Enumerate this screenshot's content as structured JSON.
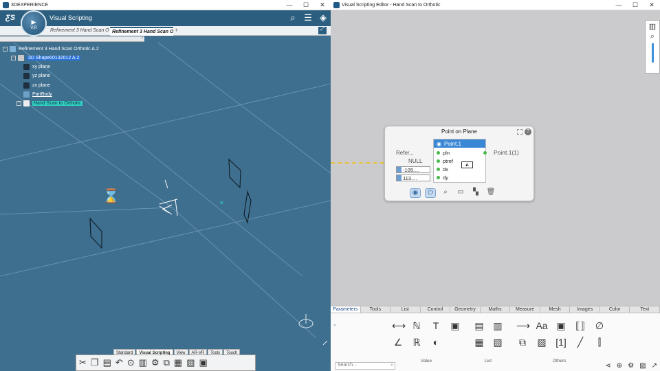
{
  "left_window": {
    "title": "3DEXPERIENCE",
    "app_title": "Visual Scripting",
    "compass_label": "V.R",
    "tabs": [
      "Refinement 3 Hand Scan O",
      "Refinement 3 Hand Scan O"
    ],
    "tree": {
      "root": "Refinement 3 Hand Scan Orthotic A.2",
      "shape": "3D Shape00132012 A.2",
      "xy": "xy plane",
      "yz": "yz plane",
      "zx": "zx plane",
      "partbody": "PartBody",
      "handscan": "Hand Scan to Orthotic"
    },
    "toolbar_tabs": [
      "Standard",
      "Visual Scripting",
      "View",
      "AR-VR",
      "Tools",
      "Touch"
    ]
  },
  "right_window": {
    "title": "Visual Scripting Editor - Hand Scan to Orthotic",
    "node": {
      "title": "Point on Plane",
      "header": "Point.1",
      "ports": [
        "pln",
        "ptref",
        "dx",
        "dy"
      ],
      "inputs": {
        "ref": "Refer...",
        "null": "NULL",
        "dx": "-105....",
        "dy": "113...."
      },
      "output": "Point.1(1)"
    },
    "palette_tabs": [
      "Parameters",
      "Tools",
      "List",
      "Control",
      "Geometry",
      "Maths",
      "Measure",
      "Mesh",
      "Images",
      "Color",
      "Text"
    ],
    "groups": {
      "value": "Value",
      "list": "List",
      "others": "Others"
    },
    "search_placeholder": "Search..."
  }
}
